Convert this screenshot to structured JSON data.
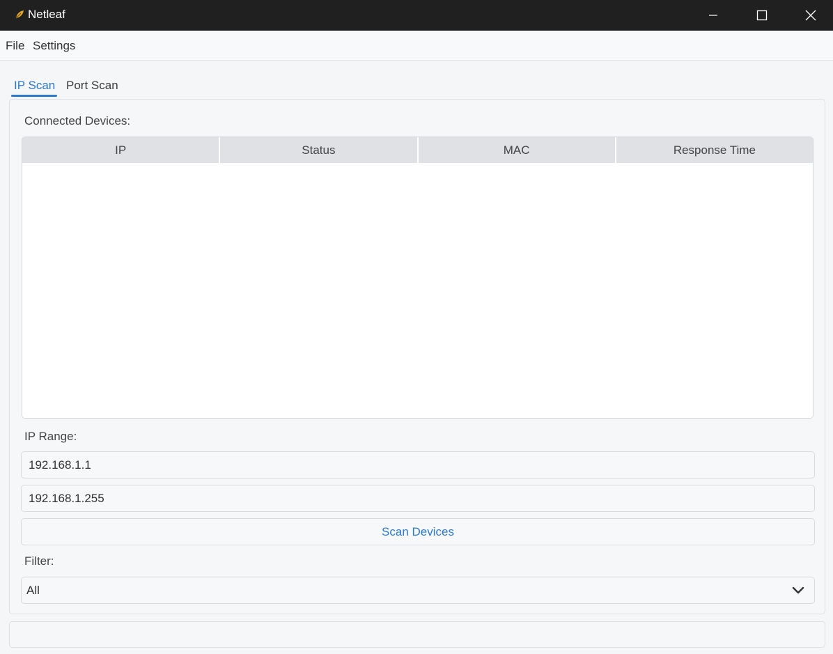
{
  "window": {
    "title": "Netleaf",
    "icon": "leaf-app-icon",
    "controls": [
      "minimize-icon",
      "maximize-icon",
      "close-icon"
    ]
  },
  "menu": {
    "items": [
      "File",
      "Settings"
    ]
  },
  "tabs": [
    {
      "label": "IP Scan",
      "active": true
    },
    {
      "label": "Port Scan",
      "active": false
    }
  ],
  "ip_scan": {
    "devices_label": "Connected Devices:",
    "table": {
      "columns": [
        "IP",
        "Status",
        "MAC",
        "Response Time"
      ],
      "rows": []
    },
    "ip_range_label": "IP Range:",
    "range_start": "192.168.1.1",
    "range_end": "192.168.1.255",
    "scan_button": "Scan Devices",
    "filter_label": "Filter:",
    "filter_value": "All"
  },
  "status_bar": {
    "text": ""
  },
  "colors": {
    "accent": "#2b79c9",
    "titlebar": "#202020",
    "header_bg": "#dfe1e5"
  }
}
